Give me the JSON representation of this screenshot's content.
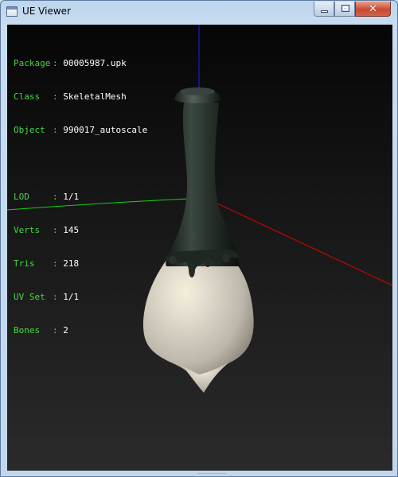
{
  "window": {
    "title": "UE Viewer",
    "controls": {
      "minimize": "",
      "maximize": "",
      "close": "✕"
    }
  },
  "info": {
    "separator": ":",
    "rows": [
      {
        "label": "Package",
        "value": "00005987.upk"
      },
      {
        "label": "Class",
        "value": "SkeletalMesh"
      },
      {
        "label": "Object",
        "value": "990017_autoscale"
      }
    ],
    "stats": [
      {
        "label": "LOD",
        "value": "1/1"
      },
      {
        "label": "Verts",
        "value": "145"
      },
      {
        "label": "Tris",
        "value": "218"
      },
      {
        "label": "UV Set",
        "value": "1/1"
      },
      {
        "label": "Bones",
        "value": "2"
      }
    ]
  },
  "scene": {
    "axis_colors": {
      "x": "#ff0000",
      "y": "#00cc00",
      "z": "#0000ff"
    },
    "mesh_colors": {
      "neck": "#2c342e",
      "body": "#dcd6cc"
    }
  }
}
